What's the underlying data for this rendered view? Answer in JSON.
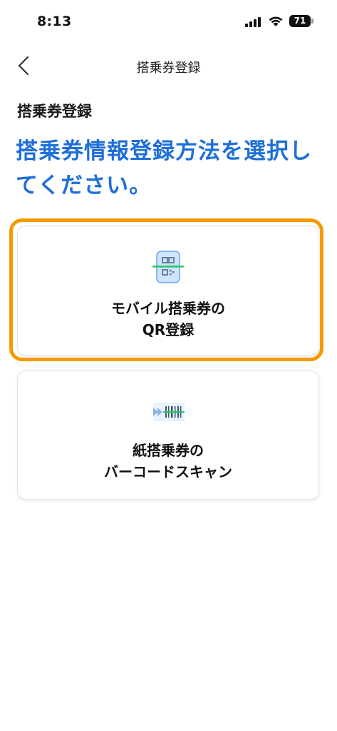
{
  "status_bar": {
    "time": "8:13",
    "battery": "71",
    "icons": [
      "signal-icon",
      "wifi-icon",
      "battery-icon"
    ]
  },
  "nav": {
    "title": "搭乗券登録",
    "back_icon": "chevron-left-icon"
  },
  "section_title": "搭乗券登録",
  "heading": {
    "line1": "搭乗券情報登録方法を選択し",
    "line2": "てください。"
  },
  "options": [
    {
      "icon": "qr-phone-icon",
      "label_line1": "モバイル搭乗券の",
      "label_line2": "QR登録",
      "highlighted": true
    },
    {
      "icon": "barcode-scan-icon",
      "label_line1": "紙搭乗券の",
      "label_line2": "バーコードスキャン",
      "highlighted": false
    }
  ],
  "colors": {
    "heading": "#1e6fd9",
    "highlight_ring": "#f59a00",
    "scan_line": "#2fc36a"
  }
}
